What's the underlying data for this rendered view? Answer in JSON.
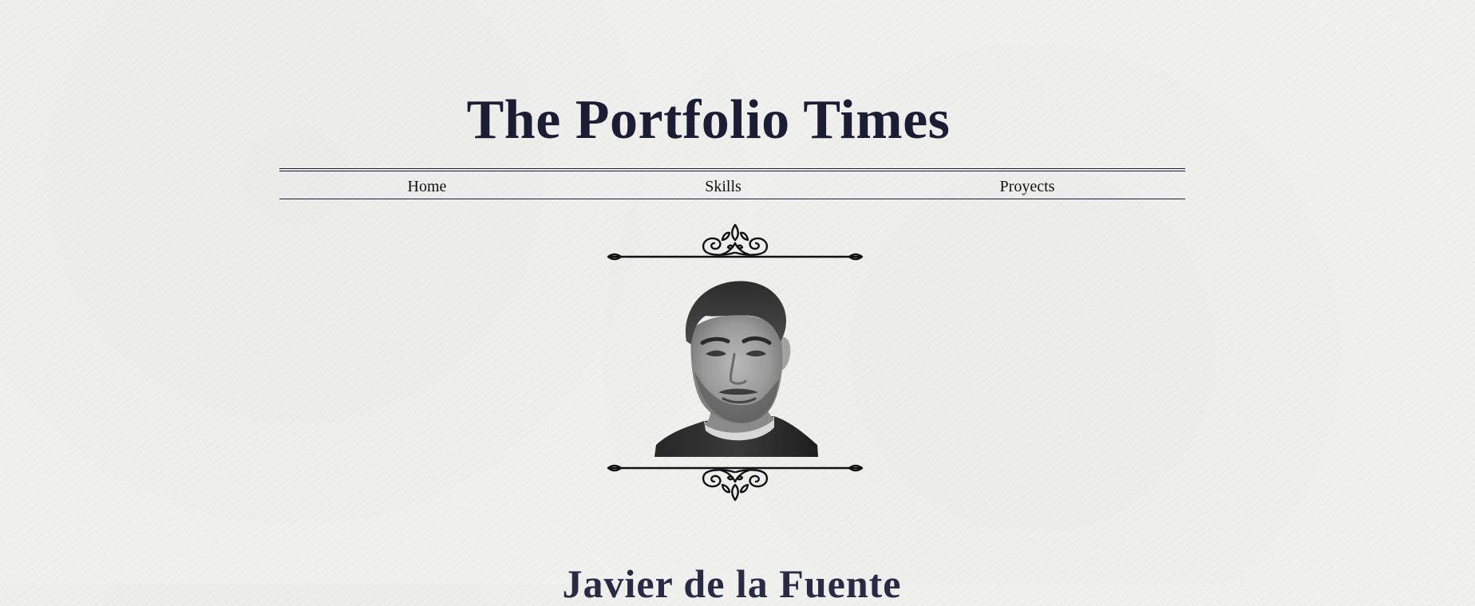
{
  "site": {
    "title": "The Portfolio Times"
  },
  "nav": {
    "items": [
      {
        "label": "Home"
      },
      {
        "label": "Skills"
      },
      {
        "label": "Proyects"
      }
    ]
  },
  "hero": {
    "name": "Javier de la Fuente"
  },
  "colors": {
    "ink": "#1c1c34",
    "paper": "#f2f2f1"
  },
  "icons": {
    "top_ornament": "flourish-divider-icon",
    "bottom_ornament": "flourish-divider-icon"
  }
}
